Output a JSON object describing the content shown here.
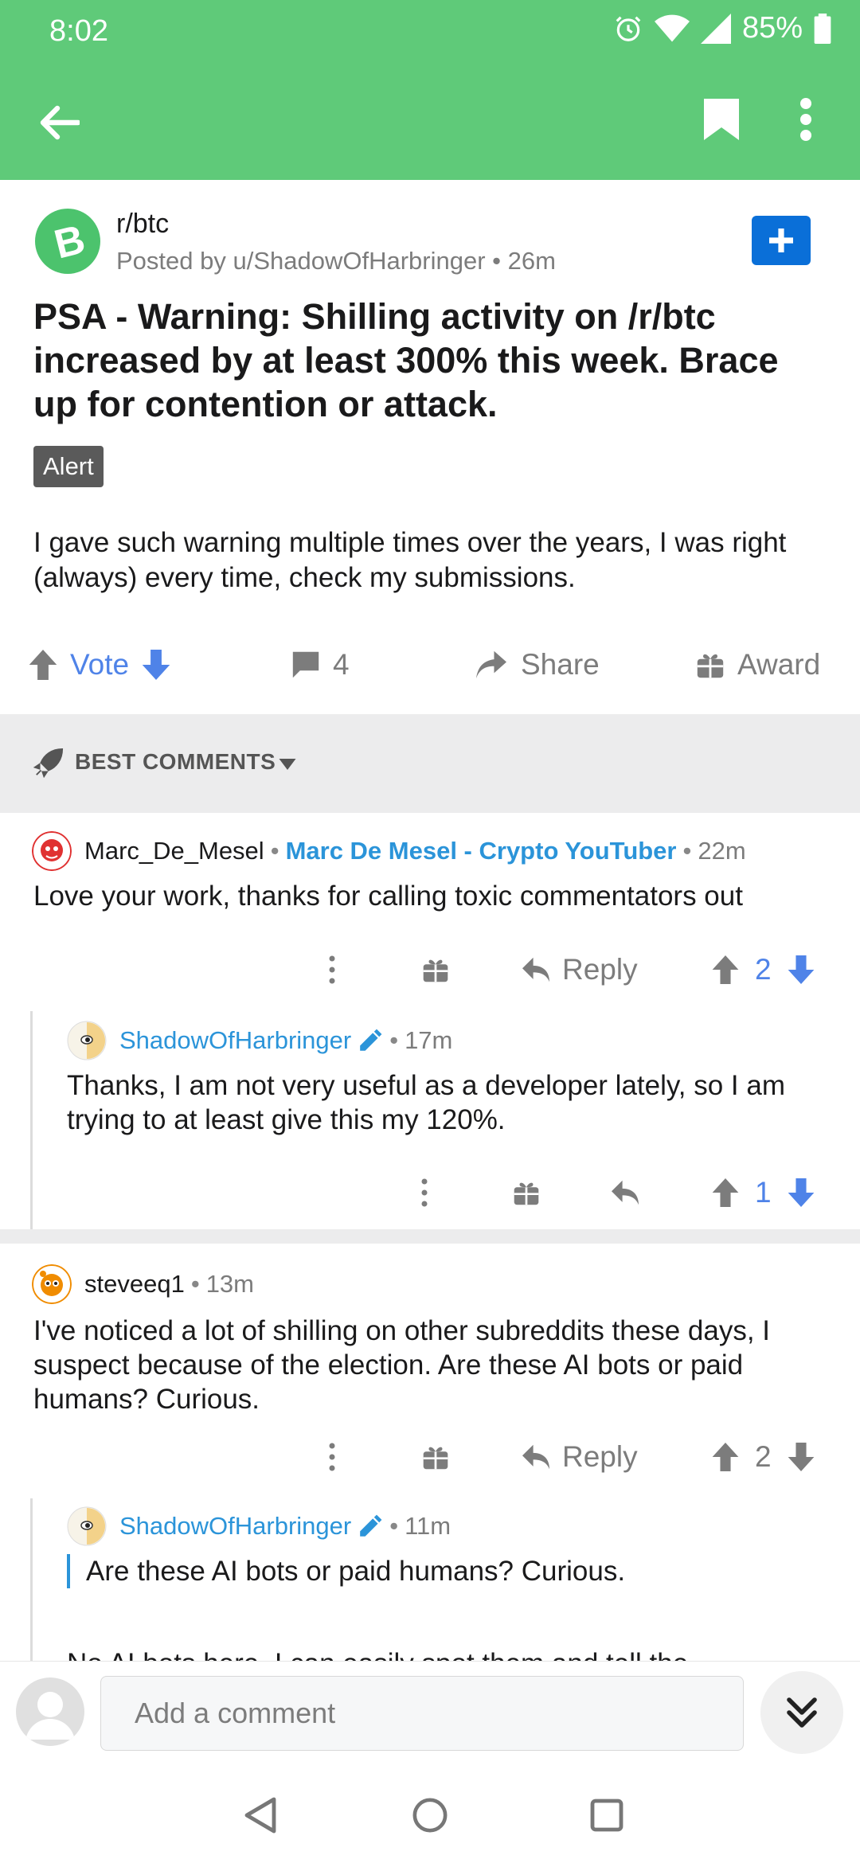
{
  "status_bar": {
    "time": "8:02",
    "battery": "85%"
  },
  "post": {
    "subreddit": "r/btc",
    "meta": "Posted by u/ShadowOfHarbringer • 26m",
    "title": "PSA - Warning: Shilling activity on /r/btc increased by at least 300% this week. Brace up for contention or attack.",
    "flair": "Alert",
    "body": "I gave such warning multiple times over the years, I was right (always) every time, check my submissions.",
    "actions": {
      "vote": "Vote",
      "comments": "4",
      "share": "Share",
      "award": "Award"
    }
  },
  "sort": {
    "label": "BEST COMMENTS"
  },
  "comments": [
    {
      "author": "Marc_De_Mesel",
      "flair": "Marc De Mesel - Crypto YouTuber",
      "time": "22m",
      "body": "Love your work, thanks for calling toxic commentators out",
      "reply_label": "Reply",
      "score": "2",
      "replies": [
        {
          "author": "ShadowOfHarbringer",
          "time": "17m",
          "body": "Thanks, I am not very useful as a developer lately, so I am trying to at least give this my 120%.",
          "score": "1"
        }
      ]
    },
    {
      "author": "steveeq1",
      "time": "13m",
      "body": "I've noticed a lot of shilling on other subreddits these days, I suspect because of the election. Are these AI bots or paid humans? Curious.",
      "reply_label": "Reply",
      "score": "2",
      "replies": [
        {
          "author": "ShadowOfHarbringer",
          "time": "11m",
          "quote": "Are these AI bots or paid humans? Curious.",
          "body_partial": "No AI bots here. I can easily spot them and tell the"
        }
      ]
    }
  ],
  "composer": {
    "placeholder": "Add a comment"
  },
  "colors": {
    "header": "#5fca79",
    "accent_blue": "#4f83e8",
    "op_blue": "#2b94d9",
    "join_button": "#0a6fd8"
  },
  "icons": [
    "back-arrow-icon",
    "bookmark-icon",
    "more-vert-icon",
    "bitcoin-cash-icon",
    "plus-icon",
    "upvote-icon",
    "downvote-icon",
    "comment-icon",
    "share-icon",
    "gift-icon",
    "rocket-icon",
    "reply-icon",
    "pencil-icon",
    "chevron-double-down-icon"
  ]
}
